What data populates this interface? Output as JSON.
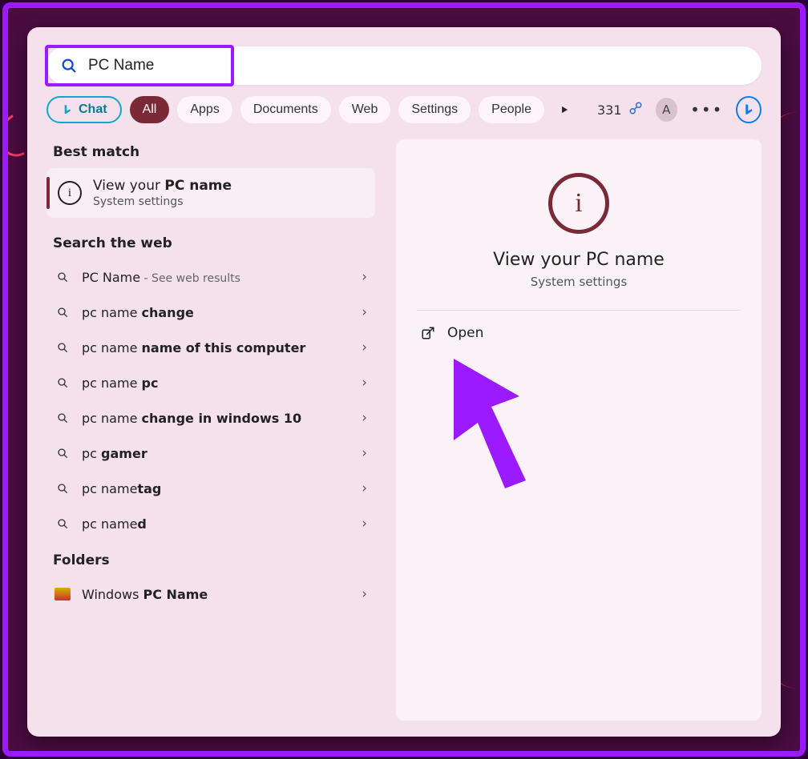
{
  "search": {
    "value": "PC Name"
  },
  "filters": {
    "chat": "Chat",
    "all": "All",
    "apps": "Apps",
    "documents": "Documents",
    "web": "Web",
    "settings": "Settings",
    "people": "People"
  },
  "rewards": {
    "points": "331"
  },
  "avatar_initial": "A",
  "sections": {
    "best_match": "Best match",
    "search_web": "Search the web",
    "folders": "Folders"
  },
  "best_match": {
    "title_pre": "View your ",
    "title_bold": "PC name",
    "subtitle": "System settings"
  },
  "web_results": [
    {
      "pre": "PC Name",
      "bold": "",
      "hint": " - See web results"
    },
    {
      "pre": "pc name ",
      "bold": "change",
      "hint": ""
    },
    {
      "pre": "pc name ",
      "bold": "name of this computer",
      "hint": ""
    },
    {
      "pre": "pc name ",
      "bold": "pc",
      "hint": ""
    },
    {
      "pre": "pc name ",
      "bold": "change in windows 10",
      "hint": ""
    },
    {
      "pre": "pc ",
      "bold": "gamer",
      "hint": ""
    },
    {
      "pre": "pc name",
      "bold": "tag",
      "hint": ""
    },
    {
      "pre": "pc name",
      "bold": "d",
      "hint": ""
    }
  ],
  "folders": [
    {
      "pre": "Windows ",
      "bold": "PC Name"
    }
  ],
  "preview": {
    "title": "View your PC name",
    "subtitle": "System settings",
    "open_label": "Open"
  },
  "colors": {
    "accent_purple": "#9b1aff",
    "accent_wine": "#7a2937",
    "panel_bg": "#f4e1ec"
  }
}
